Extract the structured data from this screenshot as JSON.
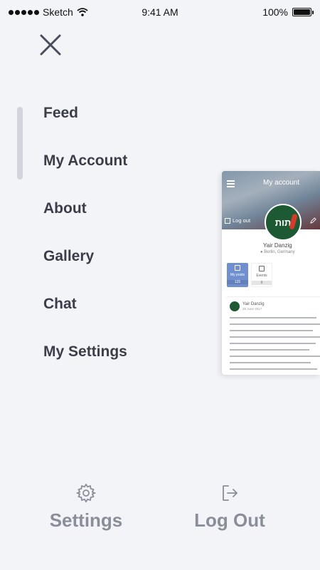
{
  "status_bar": {
    "carrier": "Sketch",
    "time": "9:41 AM",
    "battery": "100%"
  },
  "menu": {
    "items": [
      {
        "label": "Feed"
      },
      {
        "label": "My Account"
      },
      {
        "label": "About"
      },
      {
        "label": "Gallery"
      },
      {
        "label": "Chat"
      },
      {
        "label": "My Settings"
      }
    ]
  },
  "preview": {
    "title": "My account",
    "logout": "Log out",
    "avatar_text": "תות",
    "name": "Yair Danzig",
    "location": "Berlin, Germany",
    "stats": [
      {
        "label": "My posts",
        "count": "125"
      },
      {
        "label": "Events",
        "count": "0"
      }
    ],
    "post": {
      "author": "Yair Danzig",
      "date": "28 June 2017"
    }
  },
  "bottom": {
    "settings_label": "Settings",
    "logout_label": "Log Out"
  },
  "colors": {
    "background": "#f3f4f8",
    "menu_text": "#3b3d49",
    "bottom_text": "#8a8e99",
    "accent": "#6f8fcf"
  }
}
